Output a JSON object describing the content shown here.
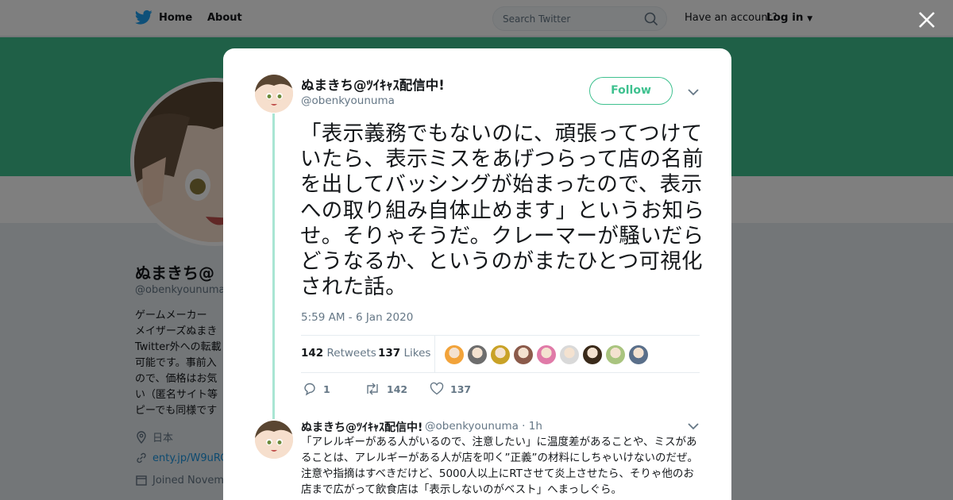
{
  "nav": {
    "home_label": "Home",
    "about_label": "About",
    "search_placeholder": "Search Twitter",
    "account_prompt": "Have an account?",
    "login_label": "Log in"
  },
  "profile": {
    "name": "ぬまきち@",
    "handle": "@obenkyounuma",
    "bio_lines": [
      "ゲームメーカー",
      "メイザーズぬまき",
      "Twitter外への転載",
      "可能です。事前入",
      "ので、価格はお気",
      "い（匿名サイト等",
      "ピーでも同様です"
    ],
    "location": "日本",
    "url": "enty.jp/W9uRC",
    "joined": "Joined Novem"
  },
  "tweet": {
    "name": "ぬまきち@ﾂｲｷｬｽ配信中!",
    "handle": "@obenkyounuma",
    "follow_label": "Follow",
    "text": "「表示義務でもないのに、頑張ってつけていたら、表示ミスをあげつらって店の名前を出してバッシングが始まったので、表示への取り組み自体止めます」というお知らせ。そりゃそうだ。クレーマーが騒いだらどうなるか、というのがまたひとつ可視化された話。",
    "timestamp": "5:59 AM - 6 Jan 2020",
    "retweet_count": "142",
    "retweet_label": "Retweets",
    "like_count": "137",
    "like_label": "Likes",
    "liker_colors": [
      "#f2a33a",
      "#6d6d6d",
      "#c9a227",
      "#8b5a4a",
      "#e07aa8",
      "#d9d9d9",
      "#3a2a1a",
      "#a9c47f",
      "#5a6f8a"
    ],
    "actions": {
      "reply_count": "1",
      "retweet_count": "142",
      "like_count": "137"
    }
  },
  "reply": {
    "name": "ぬまきち@ﾂｲｷｬｽ配信中!",
    "handle": "@obenkyounuma · 1h",
    "text": "「アレルギーがある人がいるので、注意したい」に温度差があることや、ミスがあることは、アレルギーがある人が店を叩く”正義”の材料にしちゃいけないのだぜ。注意や指摘はすべきだけど、5000人以上にRTさせて炎上させたら、そりゃ他のお店まで広がって飲食店は「表示しないのがベスト」へまっしぐら。"
  },
  "colors": {
    "brand": "#1da1f2",
    "banner": "#3ec18f",
    "thread_line": "#a9e5d3"
  }
}
